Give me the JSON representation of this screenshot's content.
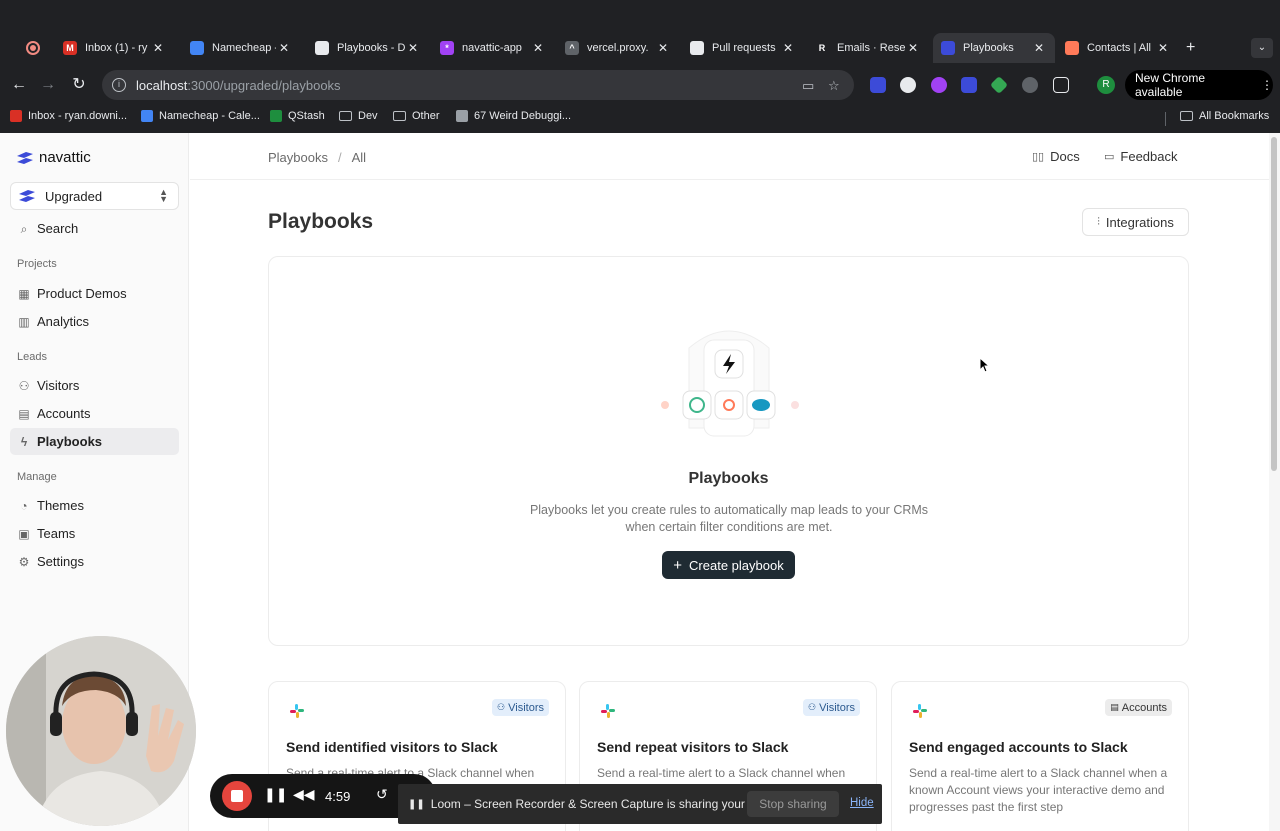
{
  "browser": {
    "tabs": [
      {
        "title": "Inbox (1) - ry",
        "favicon_color": "#d93025",
        "favicon_char": "M"
      },
      {
        "title": "Namecheap -",
        "favicon_color": "#4285f4",
        "favicon_char": ""
      },
      {
        "title": "Playbooks - D",
        "favicon_color": "#e8eaed",
        "favicon_char": ""
      },
      {
        "title": "navattic-app",
        "favicon_color": "#a142f4",
        "favicon_char": "*"
      },
      {
        "title": "vercel.proxy.",
        "favicon_color": "#5f6368",
        "favicon_char": "^"
      },
      {
        "title": "Pull requests",
        "favicon_color": "#e8eaed",
        "favicon_char": ""
      },
      {
        "title": "Emails · Rese",
        "favicon_color": "#202124",
        "favicon_char": "R"
      },
      {
        "title": "Playbooks",
        "favicon_color": "#3c4bd8",
        "favicon_char": ""
      },
      {
        "title": "Contacts | All",
        "favicon_color": "#ff7a59",
        "favicon_char": ""
      }
    ],
    "url_host": "localhost",
    "url_path": ":3000/upgraded/playbooks",
    "update_label": "New Chrome available",
    "profile_initial": "R",
    "bookmarks": [
      {
        "label": "Inbox - ryan.downi...",
        "type": "site",
        "color": "#d93025"
      },
      {
        "label": "Namecheap - Cale...",
        "type": "site",
        "color": "#4285f4"
      },
      {
        "label": "QStash",
        "type": "site",
        "color": "#1e8e3e"
      },
      {
        "label": "Dev",
        "type": "folder"
      },
      {
        "label": "Other",
        "type": "folder"
      },
      {
        "label": "67 Weird Debuggi...",
        "type": "site",
        "color": "#9aa0a6"
      }
    ],
    "all_bookmarks_label": "All Bookmarks"
  },
  "sidebar": {
    "brand": "navattic",
    "workspace": "Upgraded",
    "search_label": "Search",
    "sections": {
      "projects": "Projects",
      "leads": "Leads",
      "manage": "Manage"
    },
    "items": {
      "product_demos": "Product Demos",
      "analytics": "Analytics",
      "visitors": "Visitors",
      "accounts": "Accounts",
      "playbooks": "Playbooks",
      "themes": "Themes",
      "teams": "Teams",
      "settings": "Settings"
    },
    "active_item": "playbooks"
  },
  "topbar": {
    "breadcrumb_root": "Playbooks",
    "breadcrumb_current": "All",
    "docs_label": "Docs",
    "feedback_label": "Feedback"
  },
  "main": {
    "title": "Playbooks",
    "integrations_label": "Integrations",
    "empty_state": {
      "title": "Playbooks",
      "description": "Playbooks let you create rules to automatically map leads to your CRMs when certain filter conditions are met.",
      "button_label": "Create playbook"
    },
    "templates": [
      {
        "title": "Send identified visitors to Slack",
        "badge": "Visitors",
        "badge_type": "visitors",
        "description": "Send a real-time alert to a Slack channel when"
      },
      {
        "title": "Send repeat visitors to Slack",
        "badge": "Visitors",
        "badge_type": "visitors",
        "description": "Send a real-time alert to a Slack channel when"
      },
      {
        "title": "Send engaged accounts to Slack",
        "badge": "Accounts",
        "badge_type": "accounts",
        "description": "Send a real-time alert to a Slack channel when a known Account views your interactive demo and progresses past the first step"
      }
    ]
  },
  "loom": {
    "timer": "4:59",
    "share_message": "Loom – Screen Recorder & Screen Capture is sharing your screen.",
    "stop_label": "Stop sharing",
    "hide_label": "Hide"
  },
  "colors": {
    "primary_button": "#1f2b33",
    "active_nav_bg": "#ececee",
    "visitors_badge_bg": "#e3eefb",
    "record_red": "#e5453d"
  }
}
